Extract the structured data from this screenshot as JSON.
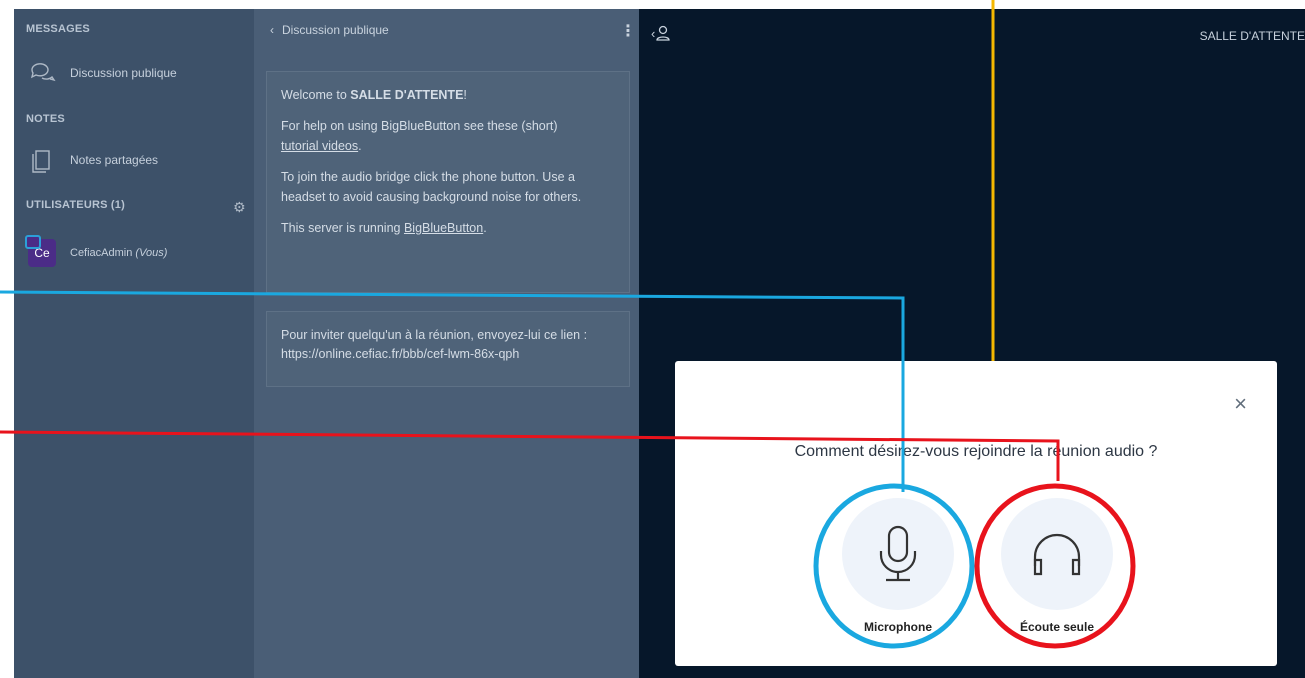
{
  "sidebar": {
    "messages_title": "MESSAGES",
    "public_chat": "Discussion publique",
    "notes_title": "NOTES",
    "shared_notes": "Notes partagées",
    "users_title": "UTILISATEURS (1)",
    "user": {
      "initials": "Ce",
      "name": "CefiacAdmin",
      "suffix": "(Vous)"
    }
  },
  "chat": {
    "header": "Discussion publique",
    "welcome_prefix": "Welcome to ",
    "welcome_room": "SALLE D'ATTENTE",
    "welcome_suffix": "!",
    "help_text": "For help on using BigBlueButton see these (short)",
    "help_link": "tutorial videos",
    "help_end": ".",
    "audio_text": "To join the audio bridge click the phone button. Use a headset to avoid causing background noise for others.",
    "server_text": "This server is running ",
    "server_link": "BigBlueButton",
    "server_end": ".",
    "invite_text": "Pour inviter quelqu'un à la réunion, envoyez-lui ce lien :",
    "invite_link": "https://online.cefiac.fr/bbb/cef-lwm-86x-qph"
  },
  "main": {
    "room_title": "SALLE D'ATTENTE"
  },
  "modal": {
    "question": "Comment désirez-vous rejoindre la réunion audio ?",
    "close_label": "×",
    "option_microphone": "Microphone",
    "option_listen": "Écoute seule"
  },
  "colors": {
    "annotation_blue": "#1aa8e0",
    "annotation_red": "#e8131c",
    "annotation_orange": "#f5b800"
  }
}
